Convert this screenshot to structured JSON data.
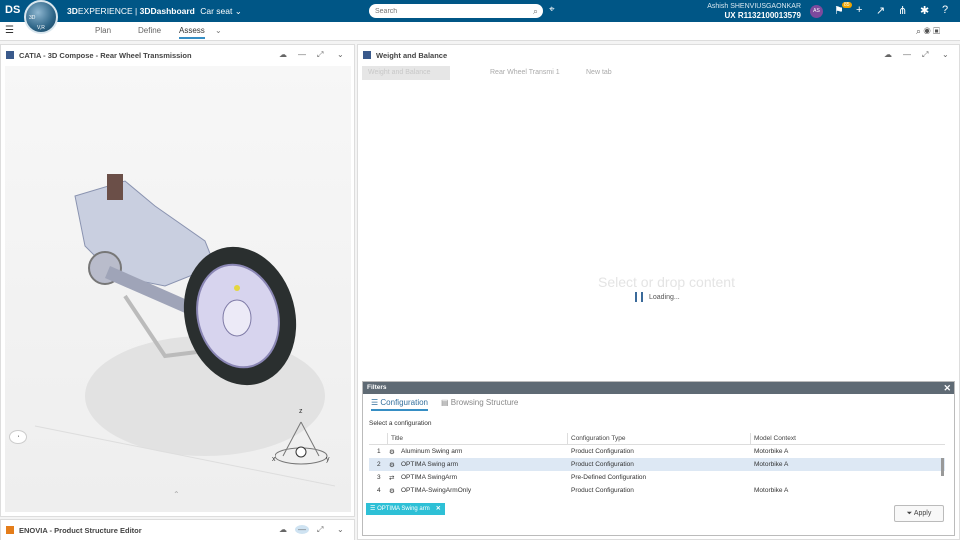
{
  "topbar": {
    "logo_glyph": "DS",
    "compass_labels": [
      "3D",
      "V,R"
    ],
    "brand_prefix": "3D",
    "brand_rest": "EXPERIENCE",
    "app": "3DDashboard",
    "context": "Car seat",
    "search_placeholder": "Search",
    "user_name": "Ashish SHENVIUSGAONKAR",
    "user_id": "UX R1132100013579",
    "avatar": "AS",
    "notification_count": "85"
  },
  "tabs": [
    {
      "label": "Plan"
    },
    {
      "label": "Define"
    },
    {
      "label": "Assess"
    }
  ],
  "left_panel": {
    "title": "CATIA - 3D Compose - Rear Wheel Transmission",
    "nav_labels": {
      "z": "z",
      "x": "x",
      "y": "y"
    }
  },
  "right_panel": {
    "title": "Weight and Balance",
    "tabs": [
      "Weight and Balance",
      "Rear Wheel Transmi 1",
      "New tab"
    ],
    "ghost_text": "Select or drop content",
    "loading_text": "Loading..."
  },
  "bottom_panel": {
    "title": "ENOVIA - Product Structure Editor"
  },
  "filters": {
    "title": "Filters",
    "tabs": [
      "Configuration",
      "Browsing Structure"
    ],
    "select_label": "Select a configuration",
    "columns": [
      "Title",
      "Configuration Type",
      "Model Context"
    ],
    "rows": [
      {
        "num": "1",
        "title": "Aluminum Swing arm",
        "type": "Product Configuration",
        "model": "Motorbike A"
      },
      {
        "num": "2",
        "title": "OPTIMA Swing arm",
        "type": "Product Configuration",
        "model": "Motorbike A"
      },
      {
        "num": "3",
        "title": "OPTIMA SwingArm",
        "type": "Pre-Defined Configuration",
        "model": ""
      },
      {
        "num": "4",
        "title": "OPTIMA-SwingArmOnly",
        "type": "Product Configuration",
        "model": "Motorbike A"
      }
    ],
    "chip": "OPTIMA Swing arm",
    "apply_label": "Apply"
  },
  "colors": {
    "topbar": "#005686",
    "accent": "#368ec4",
    "chip": "#2ec0d6"
  }
}
